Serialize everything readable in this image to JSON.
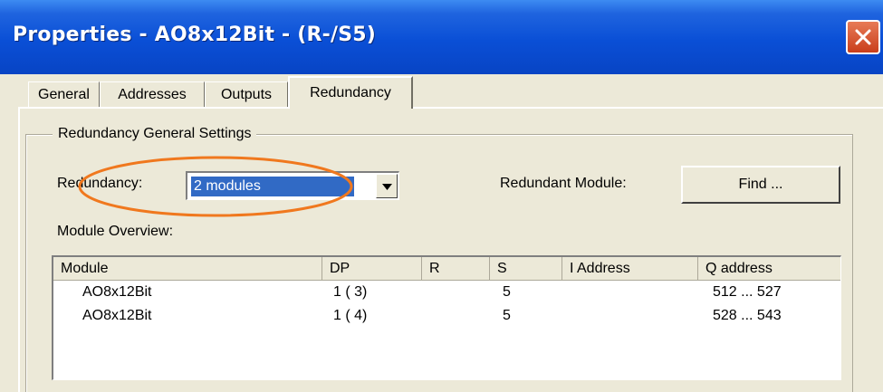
{
  "window": {
    "title": "Properties - AO8x12Bit - (R-/S5)"
  },
  "tabs": [
    {
      "label": "General"
    },
    {
      "label": "Addresses"
    },
    {
      "label": "Outputs"
    },
    {
      "label": "Redundancy",
      "active": true
    }
  ],
  "group": {
    "legend": "Redundancy General Settings",
    "redundancy_label": "Redundancy:",
    "redundancy_value": "2 modules",
    "redundant_module_label": "Redundant Module:",
    "find_button": "Find ...",
    "overview_label": "Module Overview:"
  },
  "table": {
    "columns": [
      "Module",
      "DP",
      "R",
      "S",
      "I Address",
      "Q address"
    ],
    "rows": [
      {
        "module": "AO8x12Bit",
        "dp": "1 ( 3)",
        "r": "",
        "s": "5",
        "i_address": "",
        "q_address": "512 ...  527"
      },
      {
        "module": "AO8x12Bit",
        "dp": "1 ( 4)",
        "r": "",
        "s": "5",
        "i_address": "",
        "q_address": "528 ...  543"
      }
    ]
  },
  "colors": {
    "titlebar": "#0a4fd6",
    "selection": "#316ac5",
    "highlight_ellipse": "#f0781e",
    "close_button": "#d9542c"
  }
}
